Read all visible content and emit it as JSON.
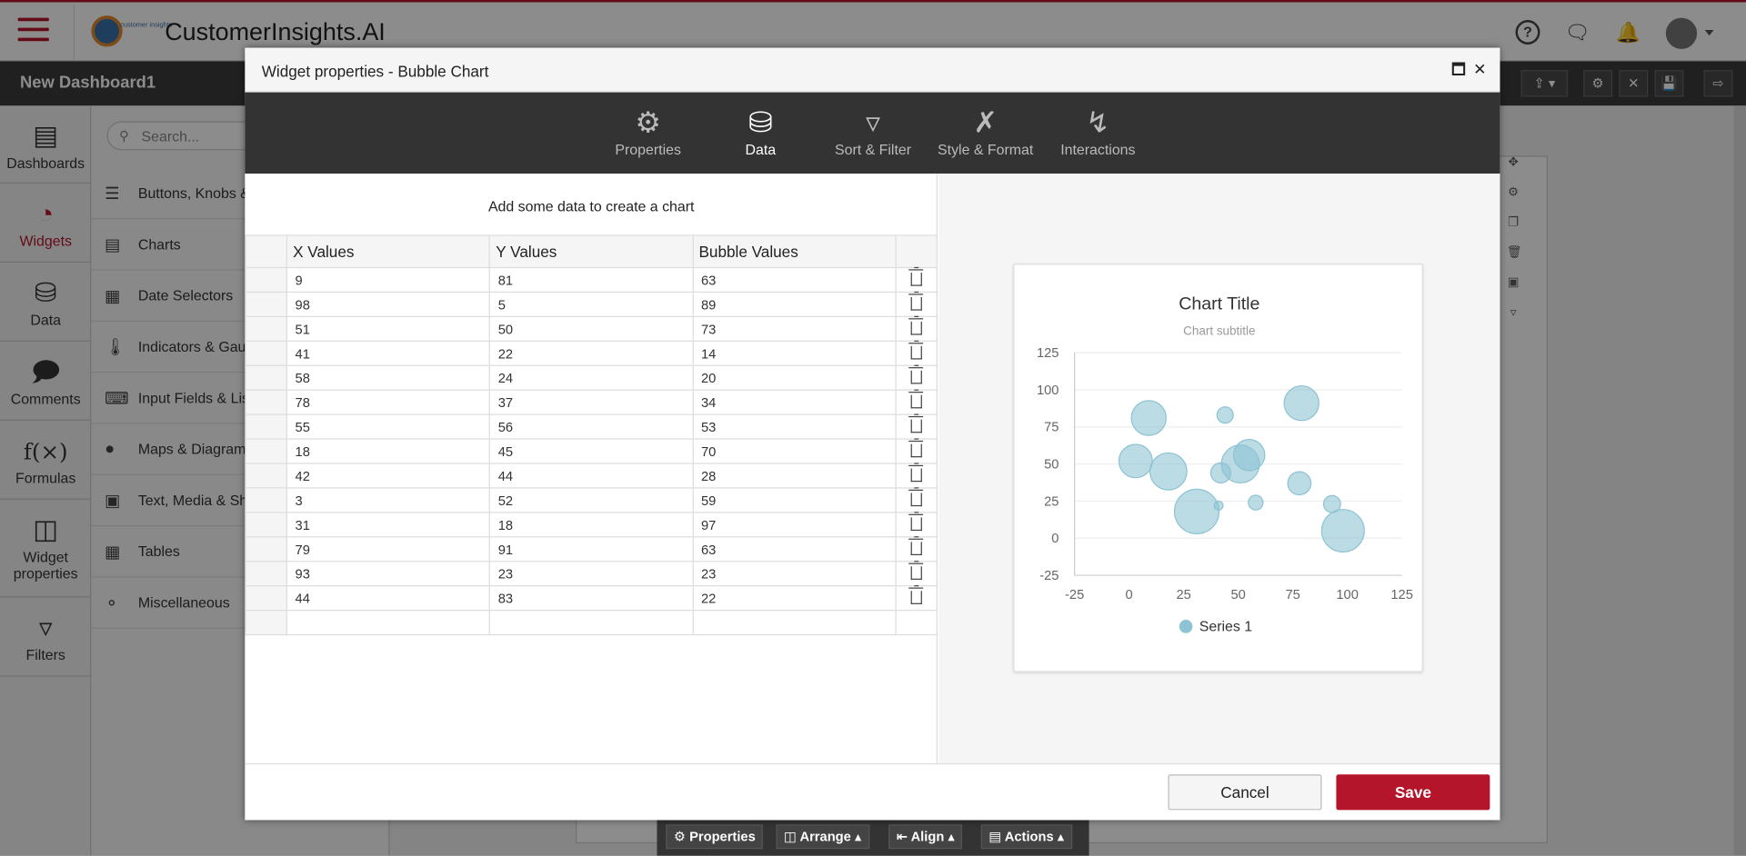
{
  "app": {
    "title": "CustomerInsights.AI",
    "logo_text": "customer insights"
  },
  "dashboard": {
    "title": "New Dashboard1"
  },
  "leftnav": [
    {
      "label": "Dashboards",
      "icon": "bar-chart-icon"
    },
    {
      "label": "Widgets",
      "icon": "gauge-icon"
    },
    {
      "label": "Data",
      "icon": "database-icon"
    },
    {
      "label": "Comments",
      "icon": "comments-icon"
    },
    {
      "label": "Formulas",
      "icon": "function-icon",
      "glyph": "f(×)"
    },
    {
      "label": "Widget properties",
      "icon": "layout-icon"
    },
    {
      "label": "Filters",
      "icon": "filter-icon"
    }
  ],
  "search": {
    "placeholder": "Search..."
  },
  "categories": [
    {
      "label": "Buttons, Knobs &"
    },
    {
      "label": "Charts"
    },
    {
      "label": "Date Selectors"
    },
    {
      "label": "Indicators & Gaug"
    },
    {
      "label": "Input Fields & List"
    },
    {
      "label": "Maps & Diagrams"
    },
    {
      "label": "Text, Media & Sha"
    },
    {
      "label": "Tables"
    },
    {
      "label": "Miscellaneous"
    }
  ],
  "bottombar": {
    "properties": "Properties",
    "arrange": "Arrange",
    "align": "Align",
    "actions": "Actions"
  },
  "modal": {
    "title": "Widget properties - Bubble Chart",
    "tabs": [
      {
        "label": "Properties",
        "icon": "gears-icon"
      },
      {
        "label": "Data",
        "icon": "database-icon"
      },
      {
        "label": "Sort & Filter",
        "icon": "filter-icon"
      },
      {
        "label": "Style & Format",
        "icon": "brush-ruler-icon"
      },
      {
        "label": "Interactions",
        "icon": "lightning-icon"
      }
    ],
    "active_tab": "Data",
    "add_message": "Add some data to create a chart",
    "columns": [
      "X Values",
      "Y Values",
      "Bubble Values"
    ],
    "rows": [
      [
        9,
        81,
        63
      ],
      [
        98,
        5,
        89
      ],
      [
        51,
        50,
        73
      ],
      [
        41,
        22,
        14
      ],
      [
        58,
        24,
        20
      ],
      [
        78,
        37,
        34
      ],
      [
        55,
        56,
        53
      ],
      [
        18,
        45,
        70
      ],
      [
        42,
        44,
        28
      ],
      [
        3,
        52,
        59
      ],
      [
        31,
        18,
        97
      ],
      [
        79,
        91,
        63
      ],
      [
        93,
        23,
        23
      ],
      [
        44,
        83,
        22
      ]
    ],
    "cancel_label": "Cancel",
    "save_label": "Save"
  },
  "colors": {
    "accent": "#b5152b",
    "bubble": "#8ec3d3"
  },
  "chart_data": {
    "type": "scatter",
    "subtype": "bubble",
    "title": "Chart Title",
    "subtitle": "Chart subtitle",
    "xlim": [
      -25,
      125
    ],
    "ylim": [
      -25,
      125
    ],
    "xticks": [
      -25,
      0,
      25,
      50,
      75,
      100,
      125
    ],
    "yticks": [
      -25,
      0,
      25,
      50,
      75,
      100,
      125
    ],
    "legend": "bottom",
    "series": [
      {
        "name": "Series 1",
        "x": [
          9,
          98,
          51,
          41,
          58,
          78,
          55,
          18,
          42,
          3,
          31,
          79,
          93,
          44
        ],
        "y": [
          81,
          5,
          50,
          22,
          24,
          37,
          56,
          45,
          44,
          52,
          18,
          91,
          23,
          83
        ],
        "z": [
          63,
          89,
          73,
          14,
          20,
          34,
          53,
          70,
          28,
          59,
          97,
          63,
          23,
          22
        ]
      }
    ]
  }
}
